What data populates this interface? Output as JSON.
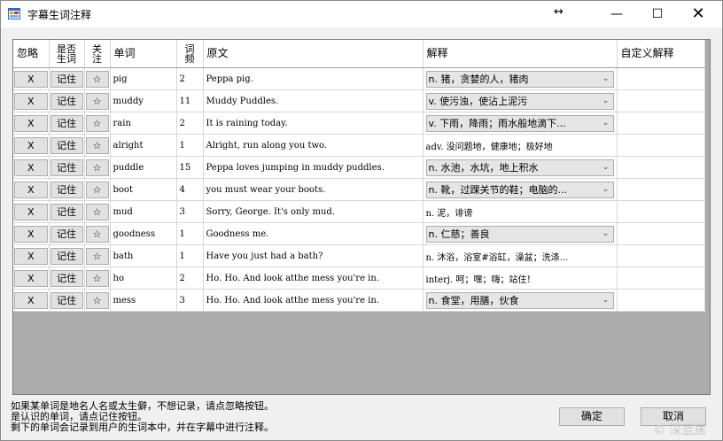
{
  "window": {
    "title": "字幕生词注释",
    "resize_glyph": "↔",
    "min_glyph": "—",
    "max_glyph": "☐",
    "close_glyph": "✕"
  },
  "grid": {
    "columns": [
      "忽略",
      "是否生词",
      "关注",
      "单词",
      "词频",
      "原文",
      "解释",
      "自定义解释"
    ],
    "rows": [
      {
        "ignore": "X",
        "remember": "记住",
        "star": "☆",
        "word": "pig",
        "freq": "2",
        "sentence": "Peppa pig.",
        "definition": "n.    猪，贪婪的人，猪肉",
        "combo": true,
        "custom": ""
      },
      {
        "ignore": "X",
        "remember": "记住",
        "star": "☆",
        "word": "muddy",
        "freq": "11",
        "sentence": "Muddy Puddles.",
        "definition": "v.    使污浊，使沾上泥污",
        "combo": true,
        "custom": ""
      },
      {
        "ignore": "X",
        "remember": "记住",
        "star": "☆",
        "word": "rain",
        "freq": "2",
        "sentence": "It is raining today.",
        "definition": "v.    下雨，降雨；雨水般地滴下...",
        "combo": true,
        "custom": ""
      },
      {
        "ignore": "X",
        "remember": "记住",
        "star": "☆",
        "word": "alright",
        "freq": "1",
        "sentence": "Alright, run along you two.",
        "definition": "adv.    没问题地，健康地；极好地",
        "combo": false,
        "custom": ""
      },
      {
        "ignore": "X",
        "remember": "记住",
        "star": "☆",
        "word": "puddle",
        "freq": "15",
        "sentence": "Peppa loves jumping in muddy puddles.",
        "definition": "n.    水池，水坑，地上积水",
        "combo": true,
        "custom": ""
      },
      {
        "ignore": "X",
        "remember": "记住",
        "star": "☆",
        "word": "boot",
        "freq": "4",
        "sentence": "you must wear your boots.",
        "definition": "n.    靴，过踝关节的鞋；电脑的...",
        "combo": true,
        "custom": ""
      },
      {
        "ignore": "X",
        "remember": "记住",
        "star": "☆",
        "word": "mud",
        "freq": "3",
        "sentence": "Sorry, George. It's only mud.",
        "definition": "n.    泥，诽谤",
        "combo": false,
        "custom": ""
      },
      {
        "ignore": "X",
        "remember": "记住",
        "star": "☆",
        "word": "goodness",
        "freq": "1",
        "sentence": "Goodness me.",
        "definition": "n.    仁慈；善良",
        "combo": true,
        "custom": ""
      },
      {
        "ignore": "X",
        "remember": "记住",
        "star": "☆",
        "word": "bath",
        "freq": "1",
        "sentence": "Have you just had a bath?",
        "definition": "n.    沐浴，浴室#浴缸，澡盆；洗涤...",
        "combo": false,
        "custom": ""
      },
      {
        "ignore": "X",
        "remember": "记住",
        "star": "☆",
        "word": "ho",
        "freq": "2",
        "sentence": "Ho. Ho. And look atthe mess you're in.",
        "definition": "interj.    呵；嘿；嗨；站住！",
        "combo": false,
        "custom": ""
      },
      {
        "ignore": "X",
        "remember": "记住",
        "star": "☆",
        "word": "mess",
        "freq": "3",
        "sentence": "Ho. Ho. And look atthe mess you're in.",
        "definition": "n.    食堂，用膳，伙食",
        "combo": true,
        "custom": ""
      }
    ]
  },
  "notes": [
    "如果某单词是地名人名或太生僻，不想记录，请点忽略按钮。",
    "是认识的单词，请点记住按钮。",
    "剩下的单词会记录到用户的生词本中，并在字幕中进行注释。"
  ],
  "buttons": {
    "ok": "确定",
    "cancel": "取消"
  },
  "watermark": "© 深蓝居",
  "colors": {
    "grid_background": "#ababab",
    "button_face": "#e1e1e1",
    "window_face": "#f0f0f0"
  }
}
